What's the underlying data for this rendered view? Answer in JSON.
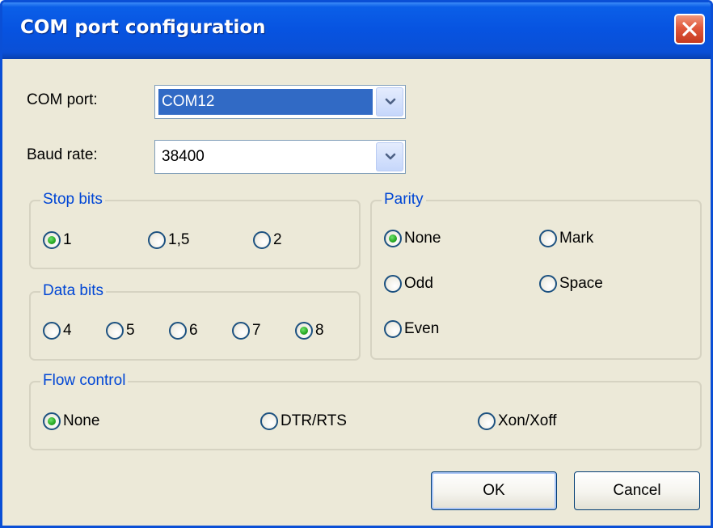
{
  "window": {
    "title": "COM port configuration"
  },
  "com_port": {
    "label": "COM port:",
    "value": "COM12"
  },
  "baud_rate": {
    "label": "Baud rate:",
    "value": "38400"
  },
  "stop_bits": {
    "title": "Stop bits",
    "options": [
      "1",
      "1,5",
      "2"
    ],
    "selected": "1"
  },
  "data_bits": {
    "title": "Data bits",
    "options": [
      "4",
      "5",
      "6",
      "7",
      "8"
    ],
    "selected": "8"
  },
  "parity": {
    "title": "Parity",
    "options": [
      "None",
      "Mark",
      "Odd",
      "Space",
      "Even"
    ],
    "selected": "None"
  },
  "flow_control": {
    "title": "Flow control",
    "options": [
      "None",
      "DTR/RTS",
      "Xon/Xoff"
    ],
    "selected": "None"
  },
  "buttons": {
    "ok": "OK",
    "cancel": "Cancel"
  },
  "icons": {
    "close": "close-icon",
    "dropdown": "chevron-down-icon"
  },
  "colors": {
    "titlebar": "#0a4fd6",
    "dialog_bg": "#ece9d8",
    "group_title": "#0046d5",
    "selection": "#316ac5",
    "radio_selected": "#27a823",
    "close_button": "#e0583c"
  }
}
